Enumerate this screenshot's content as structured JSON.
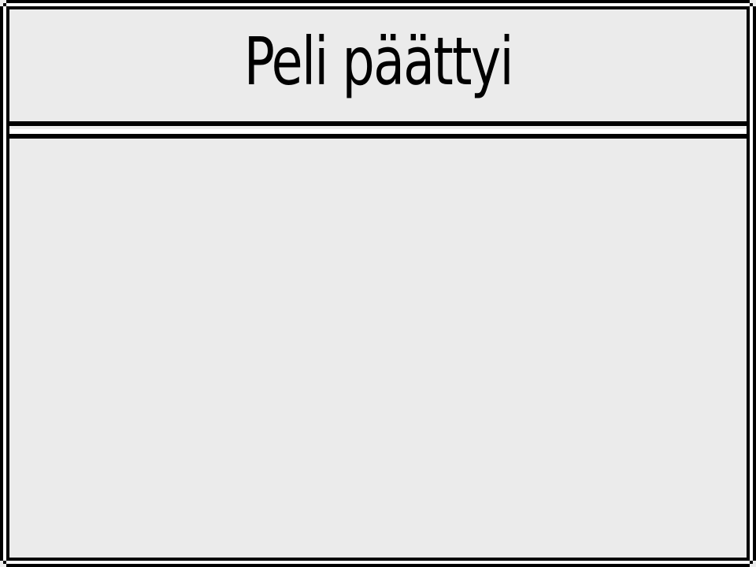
{
  "dialog": {
    "title": "Peli päättyi"
  },
  "colors": {
    "background": "#ebebeb",
    "border": "#000000",
    "highlight": "#ffffff",
    "text": "#000000"
  }
}
